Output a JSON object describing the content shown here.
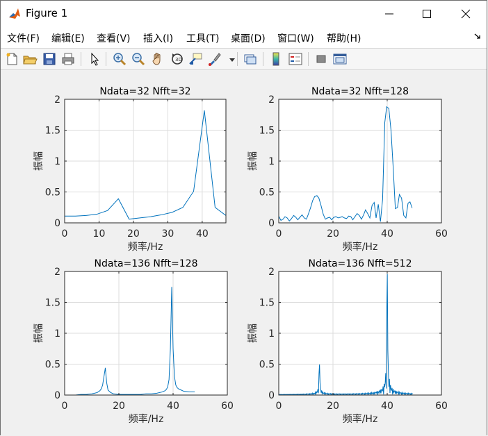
{
  "window": {
    "title": "Figure 1",
    "controls": [
      "minimize",
      "maximize",
      "close"
    ]
  },
  "menu": {
    "items": [
      "文件(F)",
      "编辑(E)",
      "查看(V)",
      "插入(I)",
      "工具(T)",
      "桌面(D)",
      "窗口(W)",
      "帮助(H)"
    ]
  },
  "toolbar": {
    "icons": [
      "new-figure-icon",
      "open-file-icon",
      "save-icon",
      "print-icon",
      "pointer-icon",
      "zoom-in-icon",
      "zoom-out-icon",
      "pan-icon",
      "rotate-3d-icon",
      "data-cursor-icon",
      "brush-icon",
      "link-plot-icon",
      "colorbar-icon",
      "legend-icon",
      "hide-plot-tools-icon",
      "show-plot-tools-icon"
    ]
  },
  "colors": {
    "line": "#0072bd",
    "axes_bg": "#ffffff",
    "figure_bg": "#f0f0f0",
    "grid": "#dcdcdc"
  },
  "chart_data": [
    {
      "type": "line",
      "title": "Ndata=32 Nfft=32",
      "xlabel": "频率/Hz",
      "ylabel": "振幅",
      "xlim": [
        0,
        46.9
      ],
      "ylim": [
        0,
        2
      ],
      "xticks": [
        0,
        10,
        20,
        30,
        40
      ],
      "yticks": [
        0,
        0.5,
        1,
        1.5,
        2
      ],
      "grid": true,
      "x": [
        0,
        3.125,
        6.25,
        9.375,
        12.5,
        15.625,
        18.75,
        21.875,
        25,
        28.125,
        31.25,
        34.375,
        37.5,
        40.625,
        43.75,
        46.875
      ],
      "y": [
        0.11,
        0.11,
        0.12,
        0.14,
        0.2,
        0.39,
        0.06,
        0.08,
        0.1,
        0.13,
        0.17,
        0.25,
        0.51,
        1.82,
        0.25,
        0.12
      ]
    },
    {
      "type": "line",
      "title": "Ndata=32 Nfft=128",
      "xlabel": "频率/Hz",
      "ylabel": "振幅",
      "xlim": [
        0,
        60
      ],
      "ylim": [
        0,
        2
      ],
      "xticks": [
        0,
        20,
        40,
        60
      ],
      "yticks": [
        0,
        0.5,
        1,
        1.5,
        2
      ],
      "grid": true,
      "x": [
        0,
        0.8,
        1.6,
        2.3,
        3.1,
        3.9,
        4.7,
        5.5,
        6.3,
        7.0,
        7.8,
        8.6,
        9.4,
        10.2,
        10.9,
        11.7,
        12.5,
        13.3,
        14.1,
        14.8,
        15.6,
        16.4,
        17.2,
        18.0,
        18.8,
        19.5,
        20.3,
        21.1,
        21.9,
        22.7,
        23.4,
        24.2,
        25.0,
        25.8,
        26.6,
        27.3,
        28.1,
        28.9,
        29.7,
        30.5,
        31.3,
        32.0,
        32.8,
        33.6,
        34.4,
        35.2,
        35.9,
        36.7,
        37.5,
        38.3,
        39.1,
        39.8,
        40.6,
        41.4,
        42.2,
        43.0,
        43.8,
        44.5,
        45.3,
        46.1,
        46.9,
        47.7,
        48.4,
        49.2
      ],
      "y": [
        0.11,
        0.04,
        0.06,
        0.1,
        0.08,
        0.03,
        0.07,
        0.12,
        0.09,
        0.05,
        0.09,
        0.13,
        0.08,
        0.06,
        0.14,
        0.24,
        0.36,
        0.43,
        0.44,
        0.4,
        0.28,
        0.14,
        0.06,
        0.08,
        0.09,
        0.05,
        0.09,
        0.1,
        0.08,
        0.09,
        0.1,
        0.08,
        0.07,
        0.11,
        0.1,
        0.05,
        0.1,
        0.15,
        0.12,
        0.06,
        0.13,
        0.21,
        0.15,
        0.08,
        0.28,
        0.33,
        0.08,
        0.3,
        0.02,
        0.38,
        1.62,
        1.88,
        1.85,
        1.5,
        0.9,
        0.23,
        0.25,
        0.46,
        0.4,
        0.12,
        0.08,
        0.32,
        0.34,
        0.24
      ]
    },
    {
      "type": "line",
      "title": "Ndata=136 Nfft=128",
      "xlabel": "频率/Hz",
      "ylabel": "振幅",
      "xlim": [
        0,
        60
      ],
      "ylim": [
        0,
        2
      ],
      "xticks": [
        0,
        20,
        40,
        60
      ],
      "yticks": [
        0,
        0.5,
        1,
        1.5,
        2
      ],
      "grid": true,
      "x": [
        0,
        2,
        4,
        6,
        8,
        10,
        11,
        12,
        13,
        13.5,
        14,
        14.5,
        15,
        15.5,
        16,
        17,
        18,
        20,
        22,
        24,
        26,
        28,
        30,
        32,
        34,
        35,
        36,
        37,
        37.5,
        38,
        38.5,
        39,
        39.5,
        40,
        40.5,
        41,
        41.5,
        42,
        43,
        44,
        46,
        48
      ],
      "y": [
        0.0,
        0.0,
        0.0,
        0.01,
        0.01,
        0.02,
        0.03,
        0.04,
        0.07,
        0.1,
        0.16,
        0.3,
        0.44,
        0.2,
        0.08,
        0.04,
        0.02,
        0.01,
        0.01,
        0.01,
        0.01,
        0.01,
        0.02,
        0.02,
        0.03,
        0.04,
        0.05,
        0.07,
        0.09,
        0.13,
        0.25,
        0.75,
        1.75,
        0.75,
        0.3,
        0.16,
        0.12,
        0.1,
        0.08,
        0.06,
        0.05,
        0.05
      ]
    },
    {
      "type": "line",
      "title": "Ndata=136 Nfft=512",
      "xlabel": "频率/Hz",
      "ylabel": "振幅",
      "xlim": [
        0,
        60
      ],
      "ylim": [
        0,
        2
      ],
      "xticks": [
        0,
        20,
        40,
        60
      ],
      "yticks": [
        0,
        0.5,
        1,
        1.5,
        2
      ],
      "grid": true,
      "peaks": [
        {
          "f0": 15,
          "amp": 0.5,
          "width": 3
        },
        {
          "f0": 40,
          "amp": 2.0,
          "width": 3
        }
      ],
      "xmax_data": 49.5
    }
  ]
}
